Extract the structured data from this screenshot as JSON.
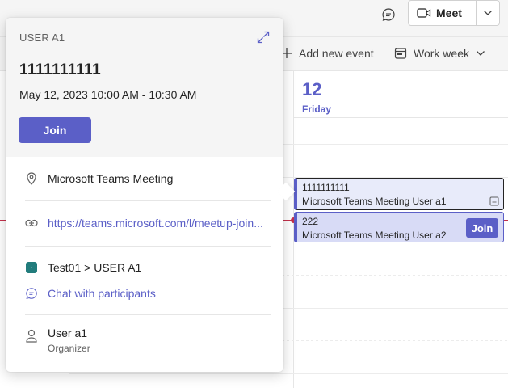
{
  "topbar": {
    "meet_label": "Meet"
  },
  "toolbar": {
    "add_event_label": "Add new event",
    "view_label": "Work week"
  },
  "day": {
    "number": "12",
    "name": "Friday"
  },
  "events": [
    {
      "title": "1111111111",
      "subtitle": "Microsoft Teams Meeting  User  a1"
    },
    {
      "title": "222",
      "subtitle": "Microsoft Teams Meeting  User a2",
      "join_label": "Join"
    }
  ],
  "card": {
    "organizer_header": "USER A1",
    "title": "1111111111",
    "time": "May 12, 2023 10:00 AM - 10:30 AM",
    "join_label": "Join",
    "location": "Microsoft Teams Meeting",
    "link": "https://teams.microsoft.com/l/meetup-join...",
    "channel": "Test01 > USER A1",
    "chat_label": "Chat with participants",
    "organizer_name": "User a1",
    "organizer_role": "Organizer"
  },
  "colors": {
    "brand": "#5b5fc7",
    "now_line": "#c4314b",
    "team": "#227c7c"
  },
  "icons": {
    "chat": "chat-bubble-icon",
    "video": "video-camera-icon",
    "plus": "plus-icon",
    "calendar": "calendar-view-icon",
    "expand": "expand-icon",
    "location": "location-pin-icon",
    "link": "link-icon",
    "person": "person-icon"
  }
}
